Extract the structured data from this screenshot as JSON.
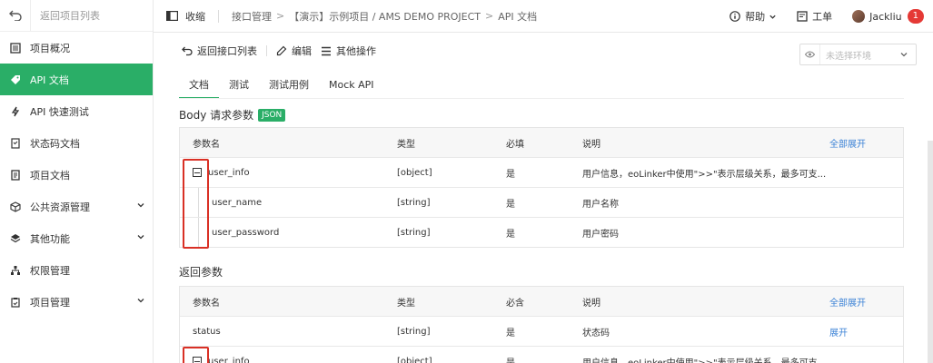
{
  "sidebar": {
    "back_label": "返回项目列表",
    "items": [
      {
        "label": "项目概况",
        "icon": "overview-icon",
        "active": false,
        "expandable": false
      },
      {
        "label": "API 文档",
        "icon": "tag-icon",
        "active": true,
        "expandable": false
      },
      {
        "label": "API 快速测试",
        "icon": "bolt-icon",
        "active": false,
        "expandable": false
      },
      {
        "label": "状态码文档",
        "icon": "doc-check-icon",
        "active": false,
        "expandable": false
      },
      {
        "label": "项目文档",
        "icon": "book-icon",
        "active": false,
        "expandable": false
      },
      {
        "label": "公共资源管理",
        "icon": "cube-icon",
        "active": false,
        "expandable": true
      },
      {
        "label": "其他功能",
        "icon": "layers-icon",
        "active": false,
        "expandable": true
      },
      {
        "label": "权限管理",
        "icon": "org-icon",
        "active": false,
        "expandable": false
      },
      {
        "label": "项目管理",
        "icon": "clipboard-icon",
        "active": false,
        "expandable": true
      }
    ]
  },
  "topbar": {
    "collapse_label": "收缩",
    "breadcrumb": [
      "接口管理",
      "【演示】示例项目 / AMS DEMO PROJECT",
      "API 文档"
    ],
    "help_label": "帮助",
    "ticket_label": "工单",
    "user_name": "Jackliu",
    "notification_count": "1"
  },
  "toolbar": {
    "back_label": "返回接口列表",
    "edit_label": "编辑",
    "more_label": "其他操作",
    "env_placeholder": "未选择环境"
  },
  "tabs": [
    "文档",
    "测试",
    "测试用例",
    "Mock API"
  ],
  "body_section": {
    "title": "Body 请求参数",
    "tag": "JSON",
    "headers": {
      "name": "参数名",
      "type": "类型",
      "required": "必填",
      "desc": "说明",
      "action": "全部展开"
    },
    "rows": [
      {
        "name": "user_info",
        "type": "[object]",
        "required": "是",
        "desc": "用户信息，eoLinker中使用\">>\"表示层级关系，最多可支...",
        "collapsible": true,
        "child": false
      },
      {
        "name": "user_name",
        "type": "[string]",
        "required": "是",
        "desc": "用户名称",
        "collapsible": false,
        "child": true
      },
      {
        "name": "user_password",
        "type": "[string]",
        "required": "是",
        "desc": "用户密码",
        "collapsible": false,
        "child": true
      }
    ]
  },
  "response_section": {
    "title": "返回参数",
    "headers": {
      "name": "参数名",
      "type": "类型",
      "required": "必含",
      "desc": "说明",
      "action": "全部展开"
    },
    "rows": [
      {
        "name": "status",
        "type": "[string]",
        "required": "是",
        "desc": "状态码",
        "action": "展开",
        "collapsible": false
      },
      {
        "name": "user_info",
        "type": "[object]",
        "required": "是",
        "desc": "用户信息，eoLinker中使用\">>\"表示层级关系，最多可支...",
        "action": "",
        "collapsible": true
      }
    ]
  },
  "colors": {
    "accent": "#2aae67",
    "highlight": "#d93025",
    "link": "#3b82d6",
    "badge": "#e53935"
  }
}
